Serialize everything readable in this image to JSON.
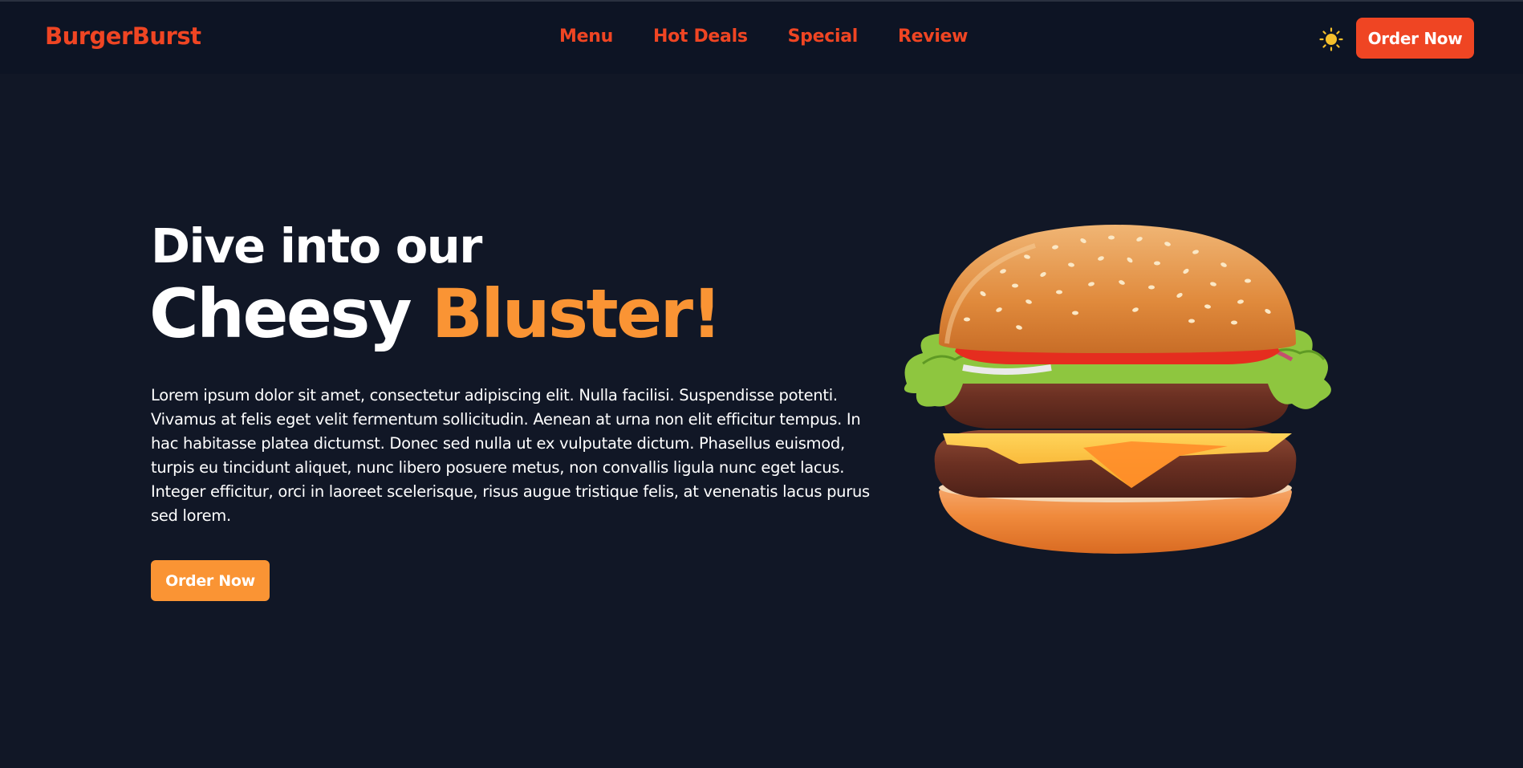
{
  "brand": {
    "name": "BurgerBurst",
    "color": "#ef4523"
  },
  "nav": {
    "items": [
      {
        "label": "Menu"
      },
      {
        "label": "Hot Deals"
      },
      {
        "label": "Special"
      },
      {
        "label": "Review"
      }
    ],
    "theme_icon": "sun-icon",
    "order_label": "Order Now"
  },
  "hero": {
    "subtitle": "Dive into our",
    "title_main": "Cheesy",
    "title_accent": "Bluster!",
    "description": "Lorem ipsum dolor sit amet, consectetur adipiscing elit. Nulla facilisi. Suspendisse potenti. Vivamus at felis eget velit fermentum sollicitudin. Aenean at urna non elit efficitur tempus. In hac habitasse platea dictumst. Donec sed nulla ut ex vulputate dictum. Phasellus euismod, turpis eu tincidunt aliquet, nunc libero posuere metus, non convallis ligula nunc eget lacus. Integer efficitur, orci in laoreet scelerisque, risus augue tristique felis, at venenatis lacus purus sed lorem.",
    "cta_label": "Order Now",
    "image": "burger-image"
  },
  "colors": {
    "background": "#111726",
    "navbar": "#0d1424",
    "primary": "#ef4523",
    "accent": "#fa9434",
    "sun": "#f6c02c"
  }
}
